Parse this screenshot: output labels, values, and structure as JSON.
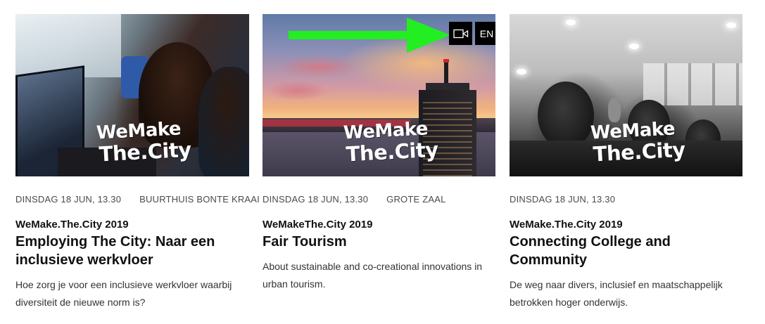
{
  "cards": [
    {
      "logo_line1": "WeMake",
      "logo_line2": "The.City",
      "date": "DINSDAG 18 JUN, 13.30",
      "location": "BUURTHUIS BONTE KRAAI",
      "series": "WeMake.The.City 2019",
      "title": "Employing The City: Naar een inclusieve werkvloer",
      "description": "Hoe zorg je voor een inclusieve werkvloer waarbij diversiteit de nieuwe norm is?"
    },
    {
      "logo_line1": "WeMake",
      "logo_line2": "The.City",
      "date": "DINSDAG 18 JUN, 13.30",
      "location": "GROTE ZAAL",
      "series": "WeMakeThe.City 2019",
      "title": "Fair Tourism",
      "description": "About sustainable and co-creational innovations in urban tourism.",
      "badges": {
        "video_icon": "video-camera-icon",
        "language": "EN"
      }
    },
    {
      "logo_line1": "WeMake",
      "logo_line2": "The.City",
      "date": "DINSDAG 18 JUN, 13.30",
      "location": "",
      "series": "WeMake.The.City 2019",
      "title": "Connecting College and Community",
      "description": "De weg naar divers, inclusief en maatschappelijk betrokken hoger onderwijs."
    }
  ],
  "annotation": {
    "arrow_color": "#22ee22"
  }
}
